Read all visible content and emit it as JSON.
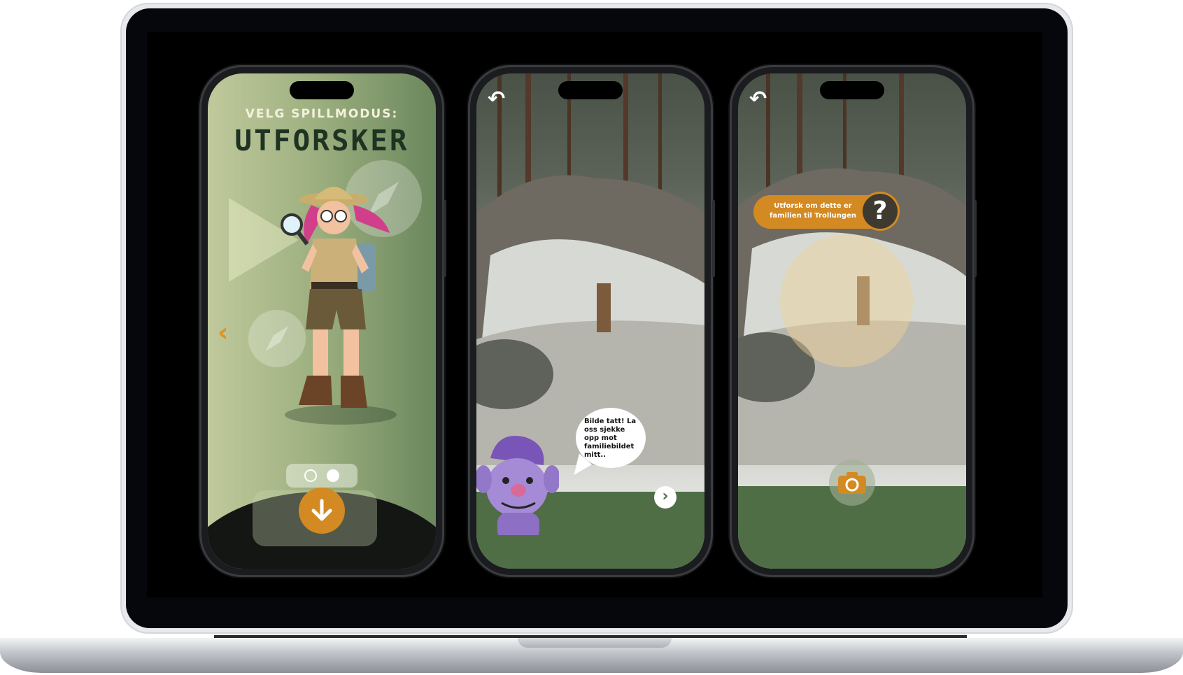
{
  "screen1": {
    "preheading": "VELG SPILLMODUS:",
    "mode_title": "UTFORSKER",
    "prev_label": "‹",
    "pagination_total": 2,
    "pagination_active": 2
  },
  "screen2": {
    "back_label": "↶",
    "speech_bubble": "Bilde tatt! La oss sjekke opp mot familiebildet mitt..",
    "next_label": "›"
  },
  "screen3": {
    "back_label": "↶",
    "hint_text": "Utforsk om dette er familien til Trollungen",
    "hint_icon_label": "?"
  },
  "colors": {
    "accent": "#d48a22",
    "forest_green": "#4f6e45",
    "title_dark": "#1f3322"
  }
}
